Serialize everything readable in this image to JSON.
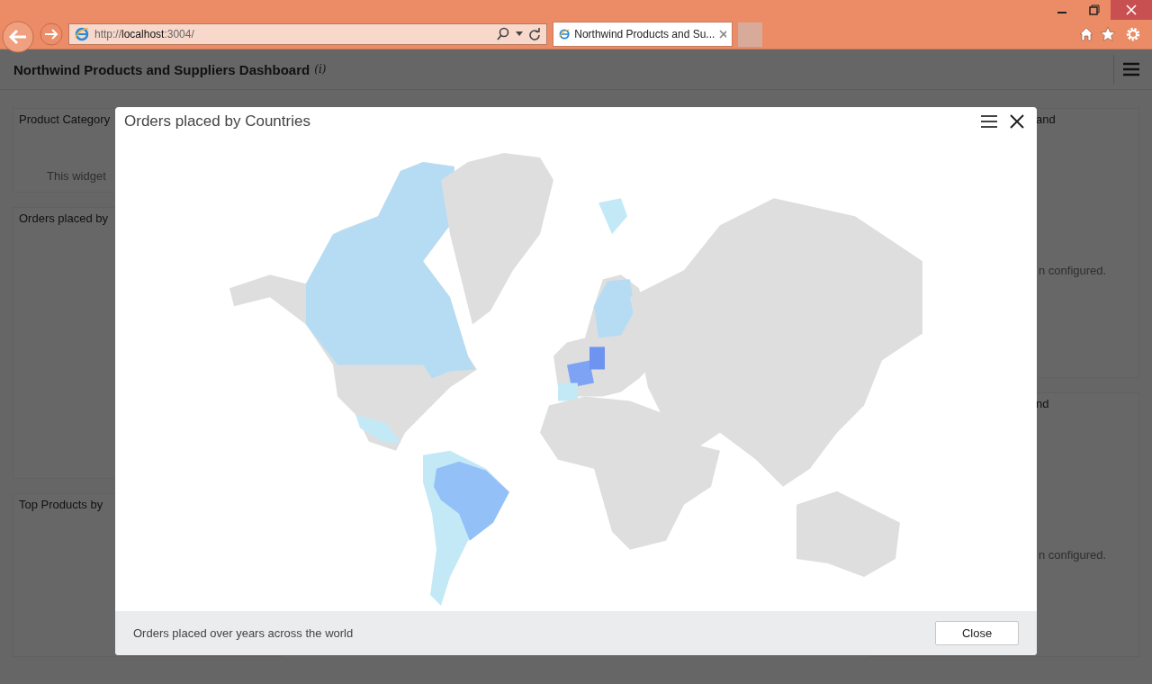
{
  "browser": {
    "address": {
      "prefix": "http://",
      "host": "localhost",
      "suffix": ":3004/"
    },
    "tab": {
      "title": "Northwind Products and Su...",
      "selected": true
    }
  },
  "dashboard": {
    "title": "Northwind Products and Suppliers Dashboard",
    "info": "(i)"
  },
  "left_widgets": [
    {
      "title": "Product Category",
      "message": "This widget"
    },
    {
      "title": "Orders placed by"
    },
    {
      "title": "Top Products by"
    }
  ],
  "right_widgets": [
    {
      "title": "and",
      "message": "n configured."
    },
    {
      "title": "nd",
      "message": "n configured."
    }
  ],
  "dialog": {
    "title": "Orders placed by Countries",
    "description": "Orders placed over years across the world",
    "button": "Close"
  }
}
